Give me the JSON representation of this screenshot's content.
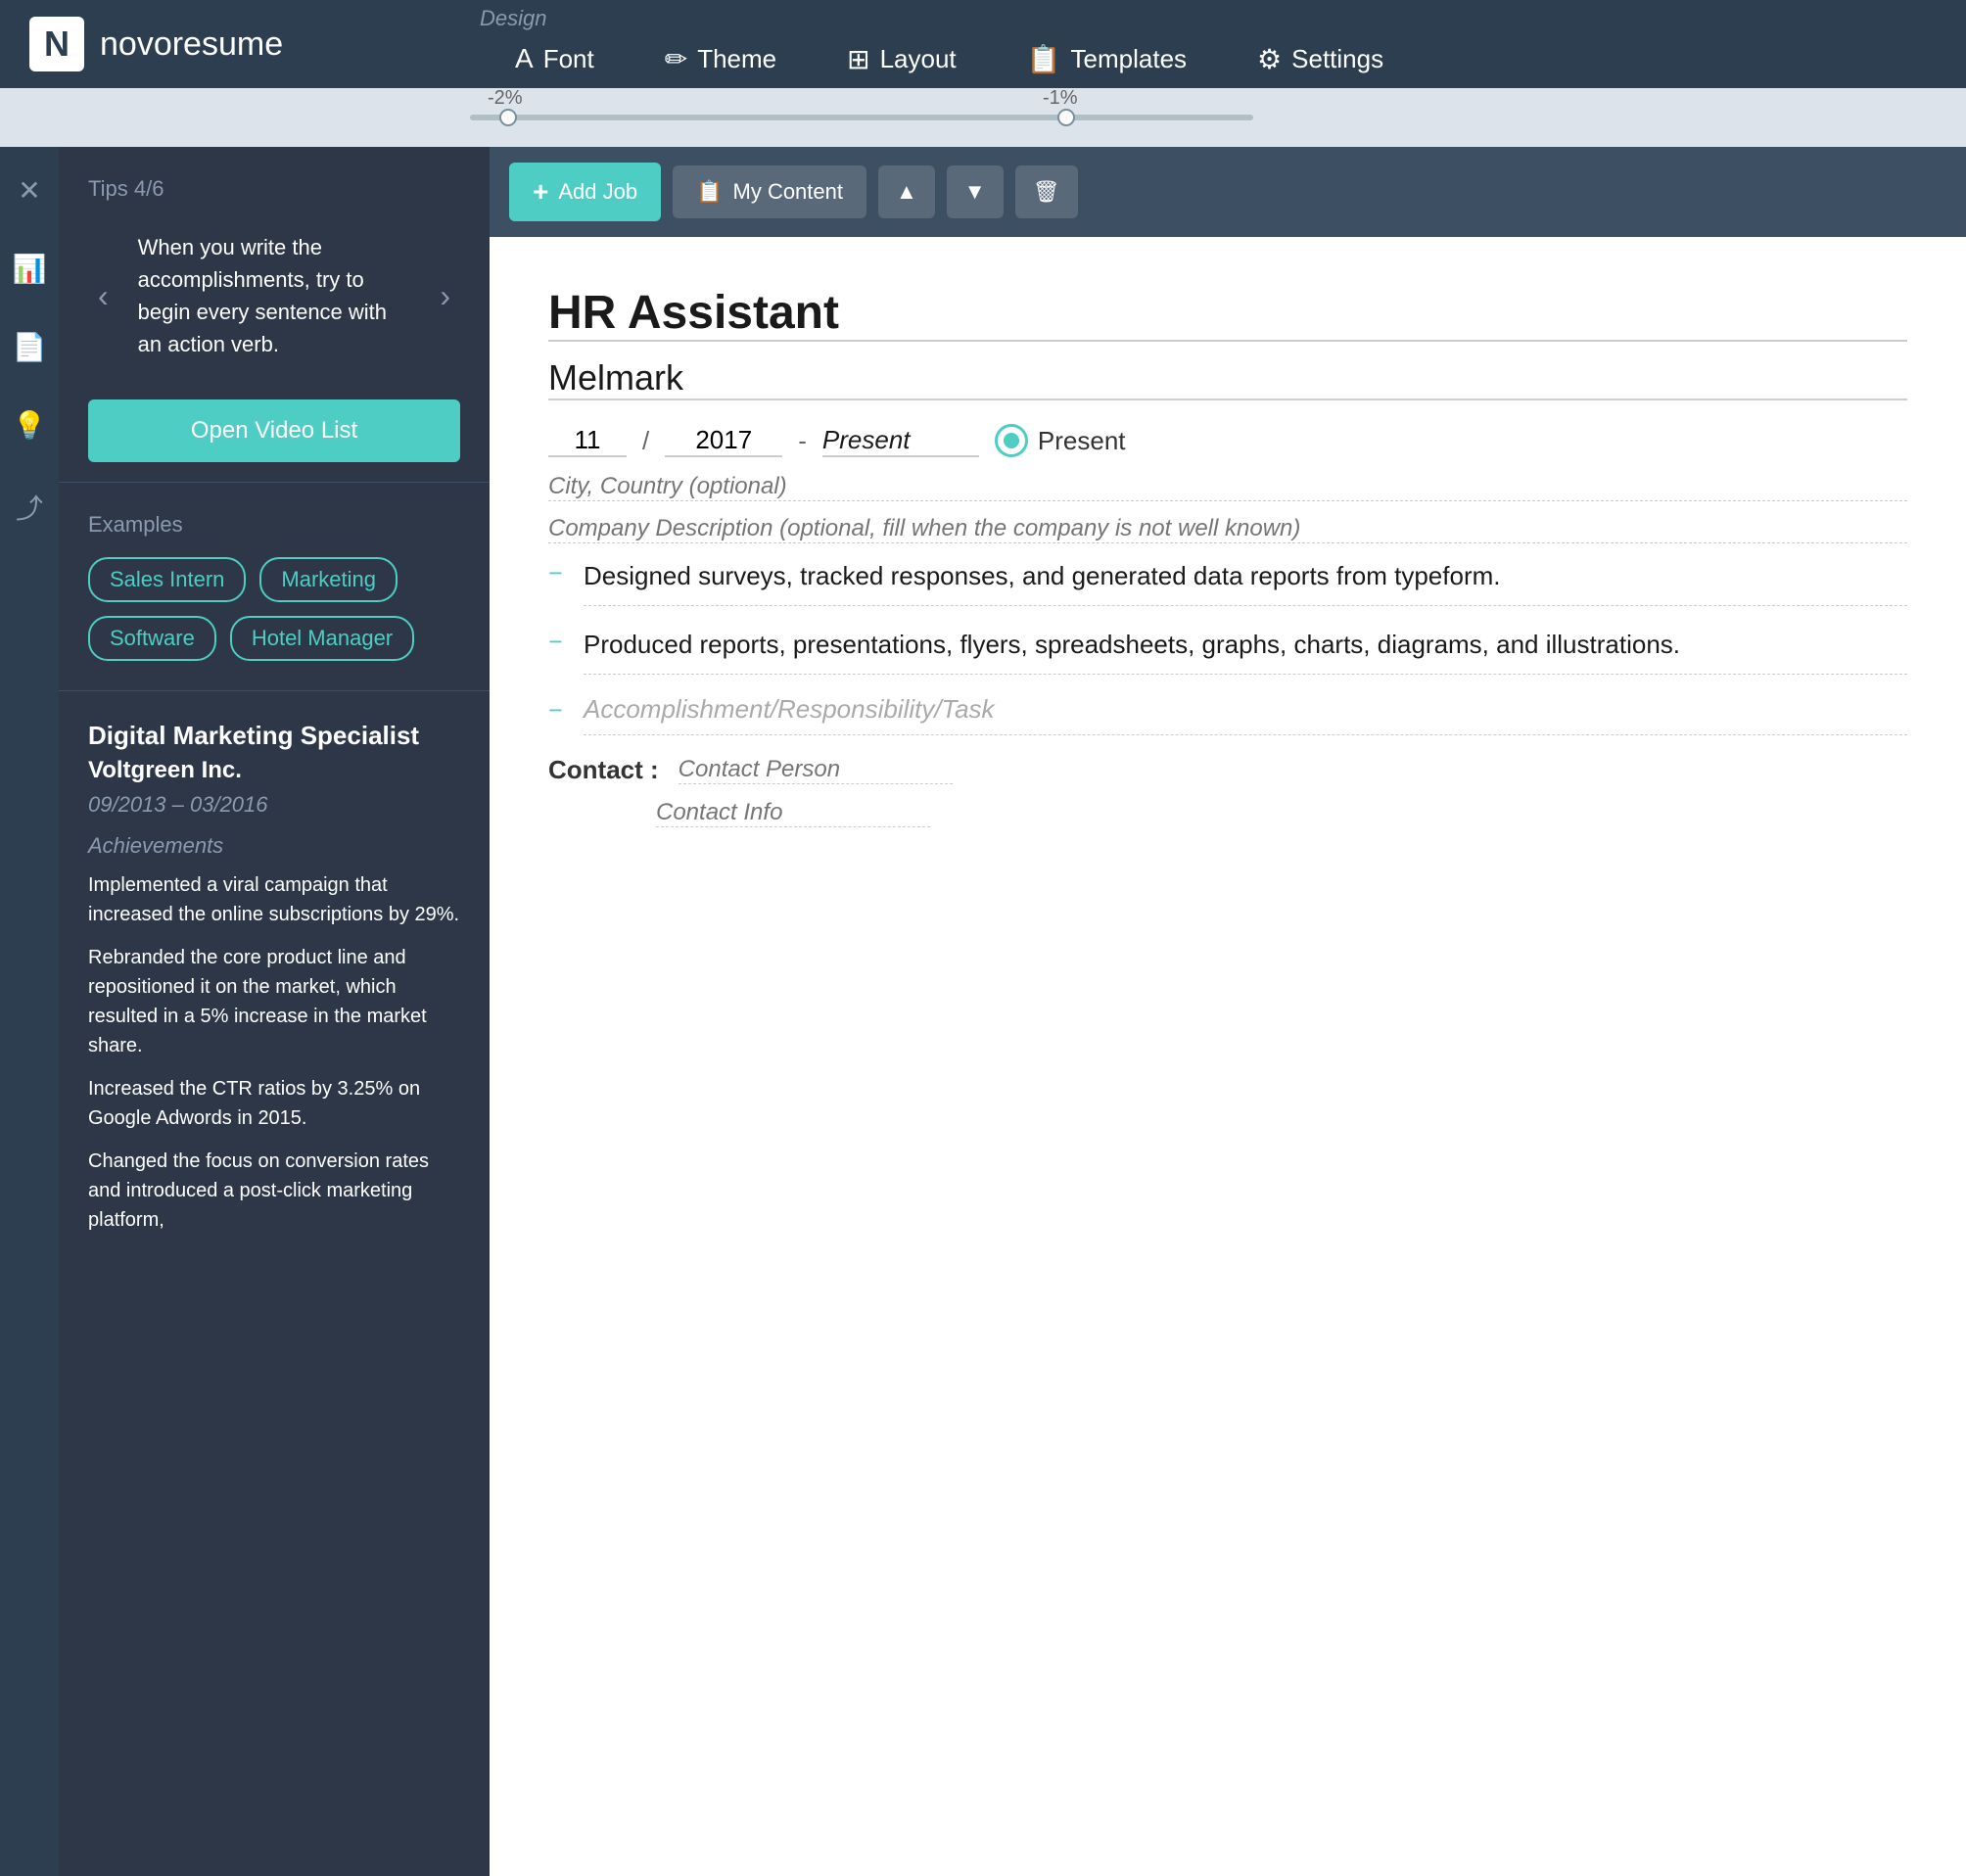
{
  "app": {
    "logo_letter": "N",
    "logo_name": "novoresume"
  },
  "top_nav": {
    "design_label": "Design",
    "items": [
      {
        "id": "font",
        "label": "Font",
        "icon": "A"
      },
      {
        "id": "theme",
        "label": "Theme",
        "icon": "✏"
      },
      {
        "id": "layout",
        "label": "Layout",
        "icon": "⊞"
      },
      {
        "id": "templates",
        "label": "Templates",
        "icon": "📋"
      },
      {
        "id": "settings",
        "label": "Settings",
        "icon": "⚙"
      }
    ]
  },
  "slider": {
    "left_label": "-2%",
    "right_label": "-1%"
  },
  "sidebar_icons": [
    {
      "id": "close",
      "icon": "✕",
      "active": false
    },
    {
      "id": "chart",
      "icon": "📊",
      "active": false
    },
    {
      "id": "document",
      "icon": "📄",
      "active": false
    },
    {
      "id": "bulb",
      "icon": "💡",
      "active": true
    },
    {
      "id": "share",
      "icon": "⤴",
      "active": false
    }
  ],
  "tips": {
    "header": "Tips 4/6",
    "text": "When you write the accomplishments, try to begin every sentence with an action verb.",
    "prev_arrow": "‹",
    "next_arrow": "›",
    "video_button": "Open Video List"
  },
  "examples": {
    "header": "Examples",
    "tags": [
      "Sales Intern",
      "Marketing",
      "Software",
      "Hotel Manager"
    ]
  },
  "past_job": {
    "title": "Digital Marketing Specialist",
    "company": "Voltgreen Inc.",
    "dates": "09/2013 – 03/2016",
    "achievements_label": "Achievements",
    "achievements": [
      "Implemented a viral campaign that increased the online subscriptions by 29%.",
      "Rebranded the core product line and repositioned it on the market, which resulted in a 5% increase in the market share.",
      "Increased the CTR ratios by 3.25% on Google Adwords in 2015.",
      "Changed the focus on conversion rates and introduced a post-click marketing platform,"
    ]
  },
  "toolbar": {
    "add_job_label": "Add Job",
    "my_content_label": "My Content",
    "up_icon": "▲",
    "down_icon": "▼",
    "delete_icon": "🗑"
  },
  "resume": {
    "job_title": "HR Assistant",
    "company": "Melmark",
    "date_month": "11",
    "date_year": "2017",
    "date_present": "Present",
    "present_radio_label": "Present",
    "city_placeholder": "City, Country (optional)",
    "company_desc_placeholder": "Company Description (optional, fill when the company is not well known)",
    "bullets": [
      {
        "text": "Designed surveys, tracked responses, and generated data reports from typeform.",
        "is_placeholder": false
      },
      {
        "text": "Produced reports, presentations, flyers, spreadsheets, graphs, charts, diagrams, and illustrations.",
        "is_placeholder": false
      },
      {
        "text": "Accomplishment/Responsibility/Task",
        "is_placeholder": true
      }
    ],
    "contact_label": "Contact :",
    "contact_person_placeholder": "Contact Person",
    "contact_info_placeholder": "Contact Info"
  }
}
